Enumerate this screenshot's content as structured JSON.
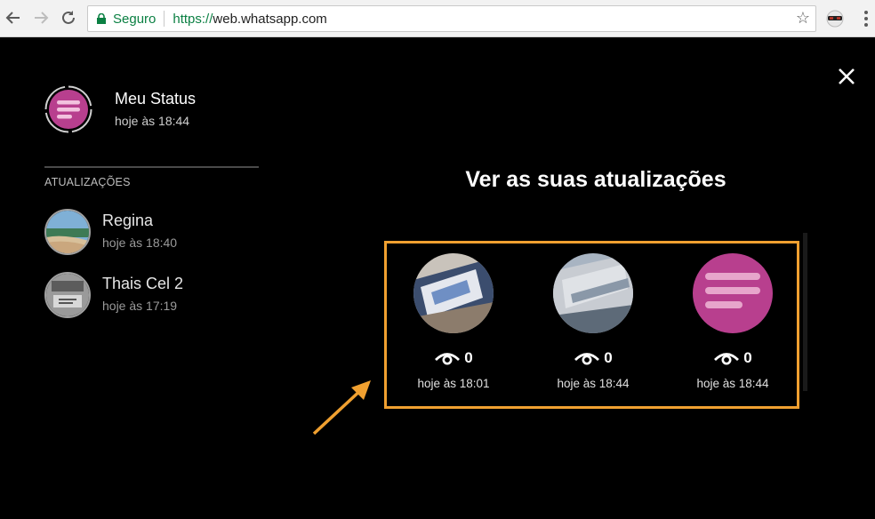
{
  "browser": {
    "secure_label": "Seguro",
    "url_scheme": "https://",
    "url_host": "web.whatsapp.com"
  },
  "my_status": {
    "name": "Meu Status",
    "time": "hoje às 18:44",
    "avatar_color": "#b83f8e"
  },
  "updates": {
    "section_label": "ATUALIZAÇÕES",
    "contacts": [
      {
        "name": "Regina",
        "time": "hoje às 18:40"
      },
      {
        "name": "Thais Cel 2",
        "time": "hoje às 17:19"
      }
    ]
  },
  "viewer": {
    "heading": "Ver as suas atualizações",
    "items": [
      {
        "views": "0",
        "time": "hoje às 18:01"
      },
      {
        "views": "0",
        "time": "hoje às 18:44"
      },
      {
        "views": "0",
        "time": "hoje às 18:44"
      }
    ]
  },
  "colors": {
    "highlight": "#f0a030",
    "status_pink": "#b83f8e"
  },
  "icons": [
    "back-icon",
    "forward-icon",
    "reload-icon",
    "lock-icon",
    "star-icon",
    "extension-icon",
    "menu-icon",
    "close-icon",
    "eye-icon",
    "arrow-annotation"
  ]
}
